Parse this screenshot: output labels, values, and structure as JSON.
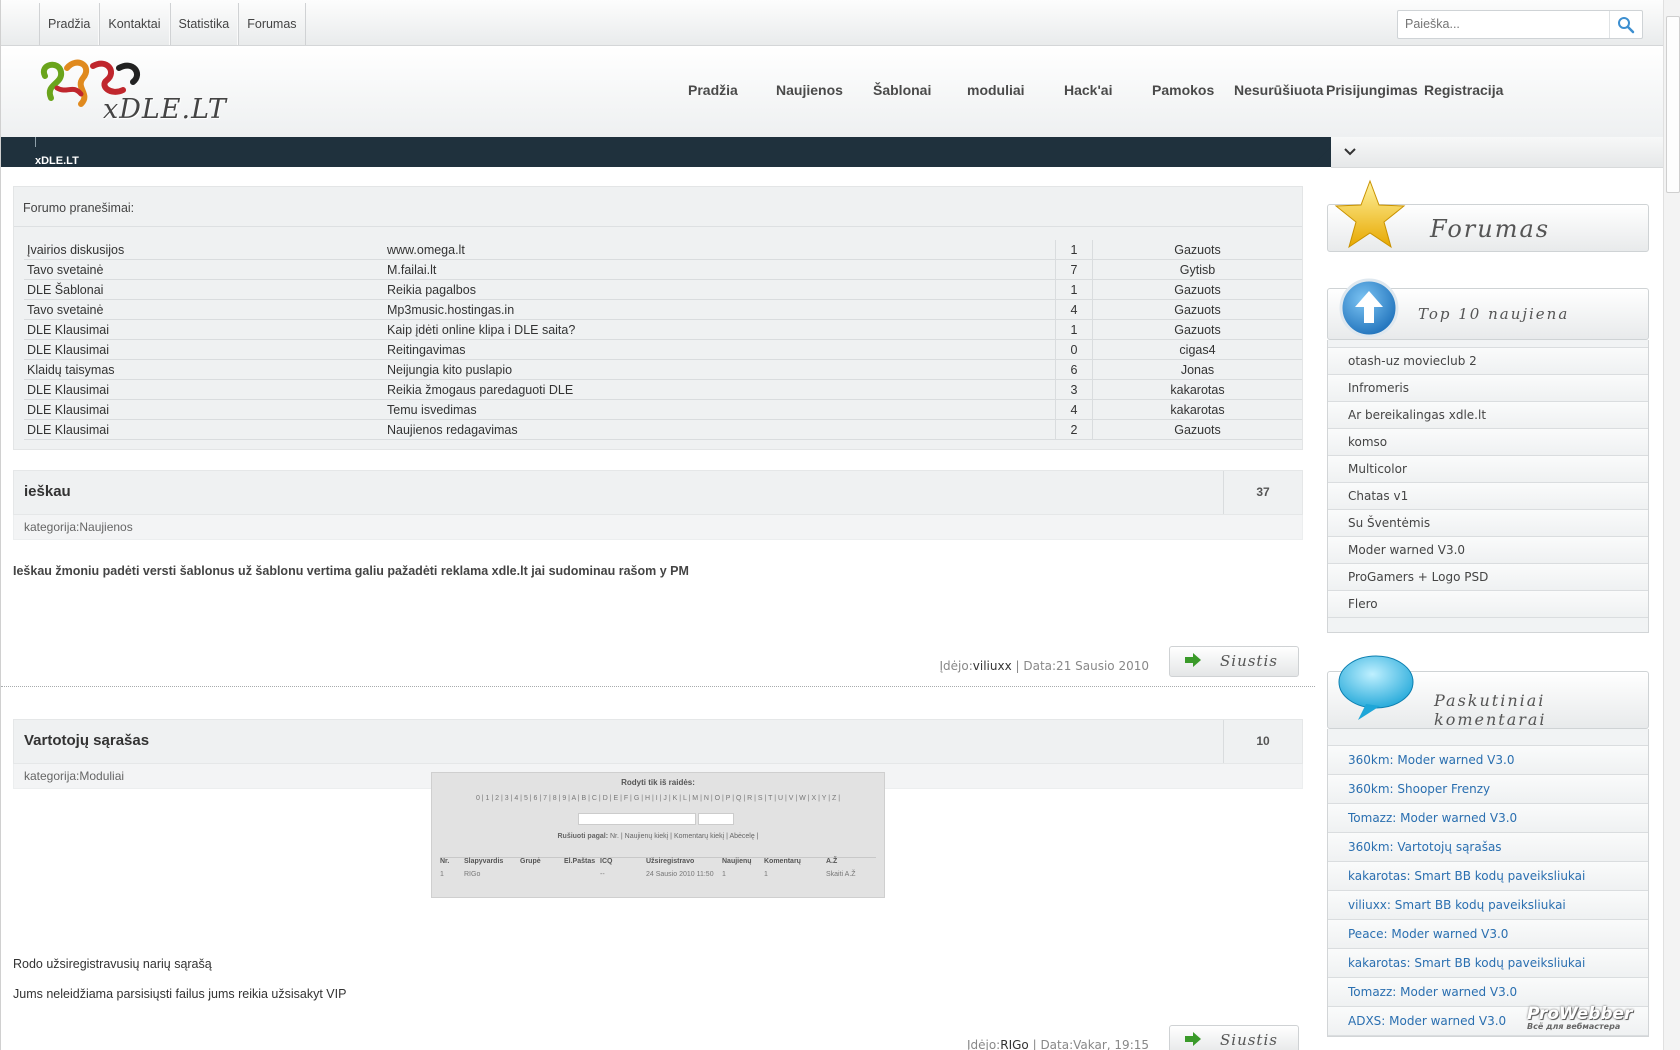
{
  "topnav": [
    "Pradžia",
    "Kontaktai",
    "Statistika",
    "Forumas"
  ],
  "search": {
    "placeholder": "Paieška..."
  },
  "logo": {
    "text": "xDLE.LT"
  },
  "mainnav": [
    "Pradžia",
    "Naujienos",
    "Šablonai",
    "moduliai",
    "Hack'ai",
    "Pamokos",
    "Nesurūšiuota",
    "Prisijungimas",
    "Registracija"
  ],
  "strip_title": "xDLE.LT",
  "forum": {
    "title": "Forumo pranešimai:",
    "rows": [
      [
        "Įvairios diskusijos",
        "www.omega.lt",
        "1",
        "Gazuots"
      ],
      [
        "Tavo svetainė",
        "M.failai.lt",
        "7",
        "Gytisb"
      ],
      [
        "DLE Šablonai",
        "Reikia pagalbos",
        "1",
        "Gazuots"
      ],
      [
        "Tavo svetainė",
        "Mp3music.hostingas.in",
        "4",
        "Gazuots"
      ],
      [
        "DLE Klausimai",
        "Kaip įdėti online klipa i DLE saita?",
        "1",
        "Gazuots"
      ],
      [
        "DLE Klausimai",
        "Reitingavimas",
        "0",
        "cigas4"
      ],
      [
        "Klaidų taisymas",
        "Neijungia kito puslapio",
        "6",
        "Jonas"
      ],
      [
        "DLE Klausimai",
        "Reikia žmogaus paredaguoti DLE",
        "3",
        "kakarotas"
      ],
      [
        "DLE Klausimai",
        "Temu isvedimas",
        "4",
        "kakarotas"
      ],
      [
        "DLE Klausimai",
        "Naujienos redagavimas",
        "2",
        "Gazuots"
      ]
    ]
  },
  "posts": [
    {
      "title": "ieškau",
      "count": "37",
      "category": "kategorija:Naujienos",
      "body": [
        "Ieškau žmoniu padėti versti šablonus už šablonu vertima galiu pažadėti reklama xdle.lt jai sudominau rašom y PM"
      ],
      "meta_prefix": "Įdėjo:",
      "author": "viliuxx",
      "date": " | Data:21 Sausio 2010",
      "button": "Siustis"
    },
    {
      "title": "Vartotojų sąrašas",
      "count": "10",
      "category": "kategorija:Moduliai",
      "body": [
        "Rodo užsiregistravusių narių sąrašą",
        "Jums neleidžiama parsisiųsti failus jums reikia užsisakyt VIP"
      ],
      "meta_prefix": "Įdėjo:",
      "author": "RIGo",
      "date": " | Data:Vakar, 19:15",
      "button": "Siustis"
    }
  ],
  "shot": {
    "title": "Rodyti tik iš raidės:",
    "letters": "0 | 1 | 2 | 3 | 4 | 5 | 6 | 7 | 8 | 9 | A | B | C | D | E | F | G | H | I | J | K | L | M | N | O | P | Q | R | S | T | U | V | W | X | Y | Z |",
    "sort_label": "Rušiuoti pagal:",
    "sort_opts": "Nr. | Naujienų kiekį | Komentarų kiekį | Abėcelę |",
    "headers": [
      "Nr.",
      "Slapyvardis",
      "Grupė",
      "El.Paštas",
      "ICQ",
      "Užsiregistravo",
      "Naujienų",
      "Komentarų",
      "A.Ž"
    ],
    "row": [
      "1",
      "RIGo",
      "",
      "",
      "--",
      "24 Sausio 2010 11:50",
      "1",
      "1",
      "Skaiti A.Ž"
    ]
  },
  "sidebar": {
    "forum_title": "Forumas",
    "top_title": "Top 10 naujiena",
    "top_items": [
      "otash-uz movieclub 2",
      "Infromeris",
      "Ar bereikalingas xdle.lt",
      "komso",
      "Multicolor",
      "Chatas v1",
      "Su Šventėmis",
      "Moder warned V3.0",
      "ProGamers + Logo PSD",
      "Flero"
    ],
    "comments_title": "Paskutiniai komentarai",
    "comments": [
      "360km: Moder warned V3.0",
      "360km: Shooper Frenzy",
      "Tomazz: Moder warned V3.0",
      "360km: Vartotojų sąrašas",
      "kakarotas: Smart BB kodų paveiksliukai",
      "viliuxx: Smart BB kodų paveiksliukai",
      "Peace: Moder warned V3.0",
      "kakarotas: Smart BB kodų paveiksliukai",
      "Tomazz: Moder warned V3.0",
      "ADXS: Moder warned V3.0"
    ]
  },
  "watermark": {
    "brand": "ProWebber",
    "tagline": "Всё для вебмастера"
  },
  "colors": {
    "strip": "#1f313d",
    "link": "#2a6fb0",
    "arrow": "#3a9a2a"
  }
}
